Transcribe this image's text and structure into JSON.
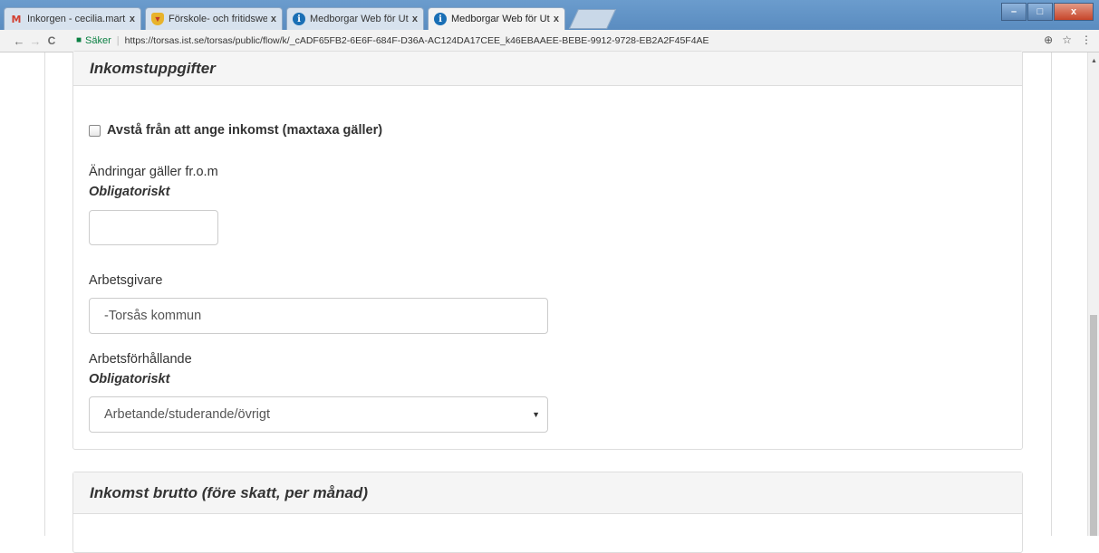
{
  "browser": {
    "tabs": [
      {
        "title": "Inkorgen - cecilia.martin",
        "icon": "gmail-icon"
      },
      {
        "title": "Förskole- och fritidswebb",
        "icon": "shield-icon"
      },
      {
        "title": "Medborgar Web för Utb",
        "icon": "info-icon"
      },
      {
        "title": "Medborgar Web för Utb",
        "icon": "info-icon"
      }
    ],
    "close_glyph": "x",
    "window_buttons": {
      "minimize": "–",
      "maximize": "□",
      "close": "x"
    },
    "back": "←",
    "forward": "→",
    "reload": "C",
    "secure_label": "Säker",
    "separator": "|",
    "url": "https://torsas.ist.se/torsas/public/flow/k/_cADF65FB2-6E6F-684F-D36A-AC124DA17CEE_k46EBAAEE-BEBE-9912-9728-EB2A2F45F4AE",
    "zoom_icon": "⊕",
    "star_icon": "☆",
    "menu_icon": "⋮"
  },
  "form": {
    "section1_title": "Inkomstuppgifter",
    "checkbox_label": "Avstå från att ange inkomst (maxtaxa gäller)",
    "checkbox_checked": false,
    "changes_label": "Ändringar gäller fr.o.m",
    "required": "Obligatoriskt",
    "changes_value": "",
    "employer_label": "Arbetsgivare",
    "employer_value": "-Torsås kommun",
    "relation_label": "Arbetsförhållande",
    "relation_value": "Arbetande/studerande/övrigt",
    "section2_title": "Inkomst brutto (före skatt, per månad)"
  },
  "colors": {
    "tab_bar": "#5a8cc0",
    "secure": "#0b8043"
  }
}
